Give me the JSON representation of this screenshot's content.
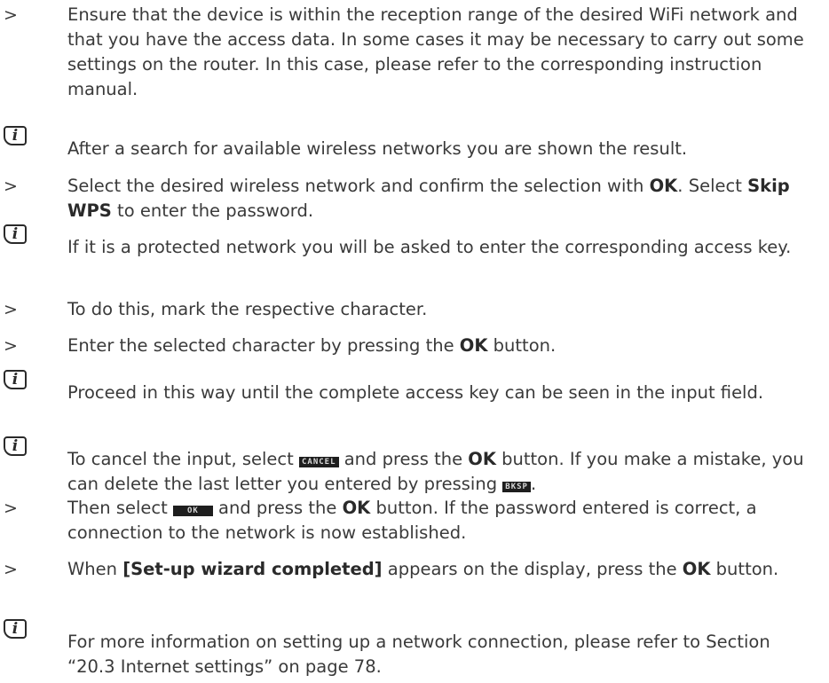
{
  "markers": {
    "arrow": ">",
    "info": "i"
  },
  "items": [
    {
      "text": "Ensure that the device is within the reception range of the desired WiFi network and that you have the access data. In some cases it may be necessary to carry out some settings on the router. In this case, please refer to the corresponding instruction manual."
    },
    {
      "text": "After a search for available wireless networks you are shown the result."
    },
    {
      "p1": "Select the desired wireless network and confirm the selection with ",
      "b1": "OK",
      "p2": ". Select ",
      "b2": "Skip WPS",
      "p3": " to enter the password."
    },
    {
      "text": "If it is a protected network you will be asked to enter the corresponding access key."
    },
    {
      "text": "To do this, mark the respective character."
    },
    {
      "p1": "Enter the selected character by pressing the ",
      "b1": "OK",
      "p2": " button."
    },
    {
      "text": "Proceed in this way until the complete access key can be seen in the input field."
    },
    {
      "p1": "To cancel the input, select ",
      "lcd1": "CANCEL",
      "p2": " and press the ",
      "b1": "OK",
      "p3": " button. If you make a mistake, you can delete the last letter you entered by pressing ",
      "lcd2": "BKSP",
      "p4": "."
    },
    {
      "p1": "Then select ",
      "lcd1": "OK",
      "p2": " and press the ",
      "b1": "OK",
      "p3": " button. If the password entered is correct, a connection to the network is now established."
    },
    {
      "p1": "When ",
      "b1": "[Set-up wizard completed]",
      "p2": " appears on the display, press the ",
      "b2": "OK",
      "p3": " button."
    },
    {
      "text": "For more information on setting up a network connection, please refer to Section “20.3 Internet settings” on page 78."
    }
  ]
}
